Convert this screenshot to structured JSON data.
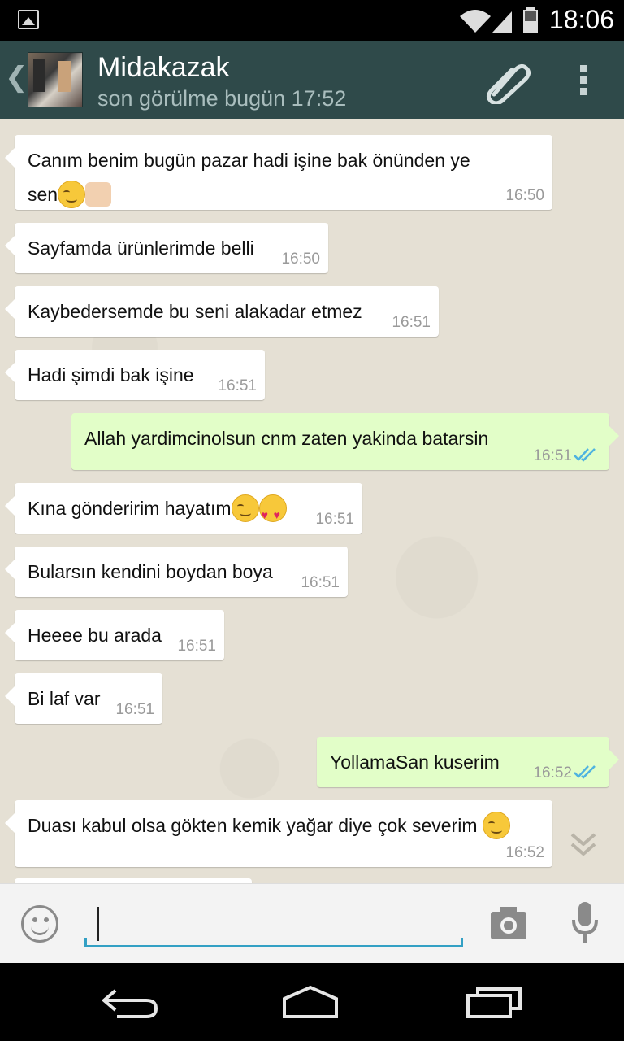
{
  "status_bar": {
    "time": "18:06",
    "icons": [
      "image-notification-icon",
      "wifi-icon",
      "signal-icon",
      "battery-icon"
    ]
  },
  "header": {
    "contact_name": "Midakazak",
    "last_seen": "son görülme bugün 17:52",
    "actions": [
      "attach-icon",
      "overflow-menu-icon"
    ]
  },
  "messages": [
    {
      "dir": "in",
      "text": "Canım benim bugün pazar hadi işine bak önünden ye",
      "text2": "sen",
      "time": "16:50"
    },
    {
      "dir": "in",
      "text": "Sayfamda ürünlerimde belli",
      "time": "16:50"
    },
    {
      "dir": "in",
      "text": "Kaybedersemde bu seni alakadar etmez",
      "time": "16:51"
    },
    {
      "dir": "in",
      "text": "Hadi şimdi bak işine",
      "time": "16:51"
    },
    {
      "dir": "out",
      "text": "Allah yardimcinolsun cnm zaten yakinda batarsin",
      "time": "16:51"
    },
    {
      "dir": "in",
      "text": "Kına gönderirim hayatım",
      "time": "16:51"
    },
    {
      "dir": "in",
      "text": "Bularsın kendini boydan boya",
      "time": "16:51"
    },
    {
      "dir": "in",
      "text": "Heeee bu arada",
      "time": "16:51"
    },
    {
      "dir": "in",
      "text": "Bi laf var",
      "time": "16:51"
    },
    {
      "dir": "out",
      "text": "YollamaSan kuserim",
      "time": "16:52"
    },
    {
      "dir": "in",
      "text": "Duası kabul olsa gökten kemik yağar diye çok severim",
      "time": "16:52"
    }
  ],
  "input": {
    "value": "",
    "placeholder": ""
  },
  "colors": {
    "header": "#2f4a4a",
    "outgoing_bubble": "#e2fec8",
    "incoming_bubble": "#ffffff",
    "read_ticks": "#4fb3e0",
    "input_underline": "#33a0c4"
  }
}
